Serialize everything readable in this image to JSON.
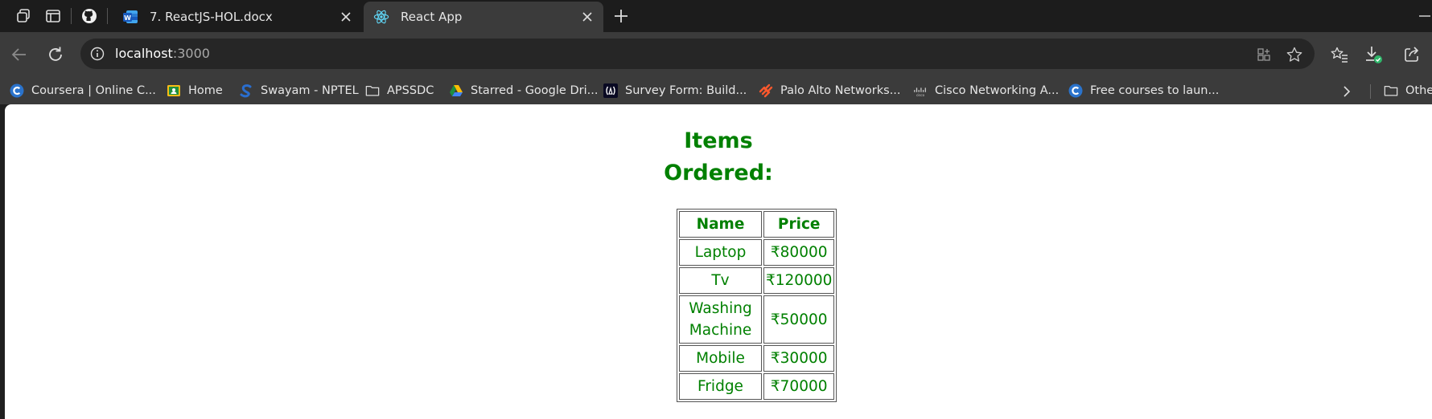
{
  "browser": {
    "tabs": [
      {
        "title": "7. ReactJS-HOL.docx",
        "icon": "word-icon",
        "active": false
      },
      {
        "title": "React App",
        "icon": "react-icon",
        "active": true
      }
    ],
    "address": {
      "host": "localhost",
      "port": ":3000"
    },
    "bookmarks": [
      {
        "label": "Coursera | Online C...",
        "icon": "coursera-icon"
      },
      {
        "label": "Home",
        "icon": "classroom-icon"
      },
      {
        "label": "Swayam - NPTEL",
        "icon": "swayam-icon"
      },
      {
        "label": "APSSDC",
        "icon": "folder-icon"
      },
      {
        "label": "Starred - Google Dri...",
        "icon": "google-drive-icon"
      },
      {
        "label": "Survey Form: Build...",
        "icon": "freecodecamp-icon"
      },
      {
        "label": "Palo Alto Networks...",
        "icon": "palo-alto-icon"
      },
      {
        "label": "Cisco Networking A...",
        "icon": "cisco-icon"
      },
      {
        "label": "Free courses to laun...",
        "icon": "coursera-icon"
      }
    ],
    "other_bookmarks": "Othe"
  },
  "page": {
    "heading": [
      "Items",
      "Ordered:"
    ],
    "table": {
      "headers": [
        "Name",
        "Price"
      ],
      "rows": [
        {
          "name": "Laptop",
          "price": "₹80000"
        },
        {
          "name": "Tv",
          "price": "₹120000"
        },
        {
          "name": "Washing Machine",
          "price": "₹50000"
        },
        {
          "name": "Mobile",
          "price": "₹30000"
        },
        {
          "name": "Fridge",
          "price": "₹70000"
        }
      ]
    },
    "text_color": "#008000"
  }
}
